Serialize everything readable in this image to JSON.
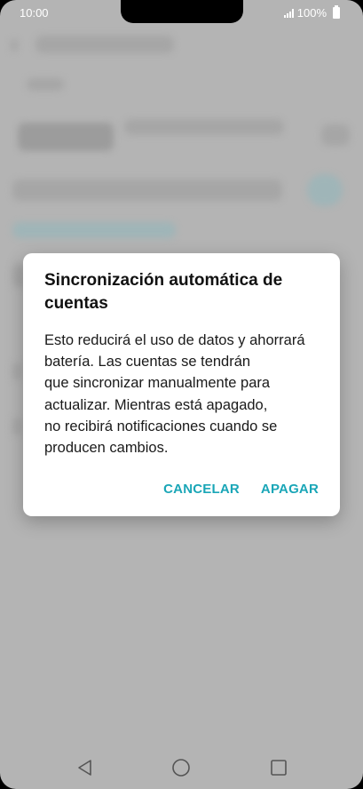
{
  "status_bar": {
    "time": "10:00",
    "battery": "100%"
  },
  "dialog": {
    "title": "Sincronización automática de cuentas",
    "message": "Esto reducirá el uso de datos y ahorrará\nbatería. Las cuentas se tendrán\nque sincronizar manualmente para\nactualizar. Mientras está apagado,\nno recibirá notificaciones cuando se\nproducen cambios.",
    "cancel_label": "CANCELAR",
    "confirm_label": "APAGAR"
  },
  "colors": {
    "accent": "#1aa6b7",
    "scrim": "#b4b4b4",
    "dialog_bg": "#ffffff"
  },
  "nav_bar": {
    "back_icon": "back-triangle-icon",
    "home_icon": "home-circle-icon",
    "recents_icon": "recents-square-icon"
  }
}
